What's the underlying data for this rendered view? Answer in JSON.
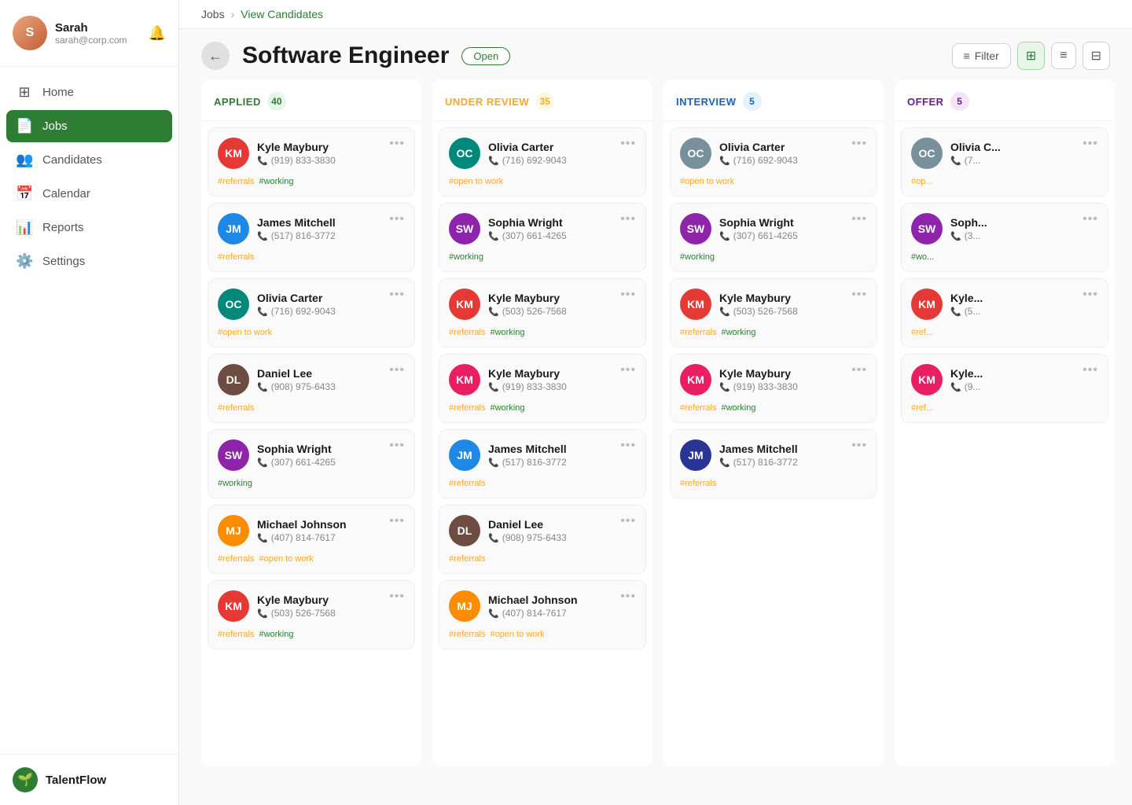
{
  "sidebar": {
    "user": {
      "name": "Sarah",
      "email": "sarah@corp.com",
      "initials": "S"
    },
    "nav": [
      {
        "id": "home",
        "label": "Home",
        "icon": "⊞"
      },
      {
        "id": "jobs",
        "label": "Jobs",
        "icon": "📄",
        "active": true
      },
      {
        "id": "candidates",
        "label": "Candidates",
        "icon": "👥"
      },
      {
        "id": "calendar",
        "label": "Calendar",
        "icon": "📅"
      },
      {
        "id": "reports",
        "label": "Reports",
        "icon": "📊"
      },
      {
        "id": "settings",
        "label": "Settings",
        "icon": "⚙️"
      }
    ],
    "brand": {
      "name": "TalentFlow",
      "icon": "🌱"
    }
  },
  "header": {
    "breadcrumb_jobs": "Jobs",
    "breadcrumb_current": "View Candidates",
    "back_button": "←",
    "title": "Software Engineer",
    "status": "Open",
    "filter_label": "Filter"
  },
  "columns": [
    {
      "id": "applied",
      "title": "APPLIED",
      "count": "40",
      "colorClass": "applied",
      "candidates": [
        {
          "name": "Kyle Maybury",
          "phone": "(919) 833-3830",
          "tags": [
            "#referrals",
            "#working"
          ],
          "tagClasses": [
            "referrals",
            "working"
          ],
          "avatarClass": "avatar-red",
          "initials": "KM"
        },
        {
          "name": "James Mitchell",
          "phone": "(517) 816-3772",
          "tags": [
            "#referrals"
          ],
          "tagClasses": [
            "referrals"
          ],
          "avatarClass": "avatar-blue",
          "initials": "JM"
        },
        {
          "name": "Olivia Carter",
          "phone": "(716) 692-9043",
          "tags": [
            "#open to work"
          ],
          "tagClasses": [
            "open-to-work"
          ],
          "avatarClass": "avatar-teal",
          "initials": "OC"
        },
        {
          "name": "Daniel Lee",
          "phone": "(908) 975-6433",
          "tags": [
            "#referrals"
          ],
          "tagClasses": [
            "referrals"
          ],
          "avatarClass": "avatar-brown",
          "initials": "DL"
        },
        {
          "name": "Sophia Wright",
          "phone": "(307) 661-4265",
          "tags": [
            "#working"
          ],
          "tagClasses": [
            "working"
          ],
          "avatarClass": "avatar-purple",
          "initials": "SW"
        },
        {
          "name": "Michael Johnson",
          "phone": "(407) 814-7617",
          "tags": [
            "#referrals",
            "#open to work"
          ],
          "tagClasses": [
            "referrals",
            "open-to-work"
          ],
          "avatarClass": "avatar-orange",
          "initials": "MJ"
        },
        {
          "name": "Kyle Maybury",
          "phone": "(503) 526-7568",
          "tags": [
            "#referrals",
            "#working"
          ],
          "tagClasses": [
            "referrals",
            "working"
          ],
          "avatarClass": "avatar-red",
          "initials": "KM"
        }
      ]
    },
    {
      "id": "review",
      "title": "UNDER REVIEW",
      "count": "35",
      "colorClass": "review",
      "candidates": [
        {
          "name": "Olivia Carter",
          "phone": "(716) 692-9043",
          "tags": [
            "#open to work"
          ],
          "tagClasses": [
            "open-to-work"
          ],
          "avatarClass": "avatar-teal",
          "initials": "OC"
        },
        {
          "name": "Sophia Wright",
          "phone": "(307) 661-4265",
          "tags": [
            "#working"
          ],
          "tagClasses": [
            "working"
          ],
          "avatarClass": "avatar-purple",
          "initials": "SW"
        },
        {
          "name": "Kyle Maybury",
          "phone": "(503) 526-7568",
          "tags": [
            "#referrals",
            "#working"
          ],
          "tagClasses": [
            "referrals",
            "working"
          ],
          "avatarClass": "avatar-red",
          "initials": "KM"
        },
        {
          "name": "Kyle Maybury",
          "phone": "(919) 833-3830",
          "tags": [
            "#referrals",
            "#working"
          ],
          "tagClasses": [
            "referrals",
            "working"
          ],
          "avatarClass": "avatar-pink",
          "initials": "KM"
        },
        {
          "name": "James Mitchell",
          "phone": "(517) 816-3772",
          "tags": [
            "#referrals"
          ],
          "tagClasses": [
            "referrals"
          ],
          "avatarClass": "avatar-blue",
          "initials": "JM"
        },
        {
          "name": "Daniel Lee",
          "phone": "(908) 975-6433",
          "tags": [
            "#referrals"
          ],
          "tagClasses": [
            "referrals"
          ],
          "avatarClass": "avatar-brown",
          "initials": "DL"
        },
        {
          "name": "Michael Johnson",
          "phone": "(407) 814-7617",
          "tags": [
            "#referrals",
            "#open to work"
          ],
          "tagClasses": [
            "referrals",
            "open-to-work"
          ],
          "avatarClass": "avatar-orange",
          "initials": "MJ"
        }
      ]
    },
    {
      "id": "interview",
      "title": "INTERVIEW",
      "count": "5",
      "colorClass": "interview",
      "candidates": [
        {
          "name": "Olivia Carter",
          "phone": "(716) 692-9043",
          "tags": [
            "#open to work"
          ],
          "tagClasses": [
            "open-to-work"
          ],
          "avatarClass": "avatar-grey",
          "initials": "OC"
        },
        {
          "name": "Sophia Wright",
          "phone": "(307) 661-4265",
          "tags": [
            "#working"
          ],
          "tagClasses": [
            "working"
          ],
          "avatarClass": "avatar-purple",
          "initials": "SW"
        },
        {
          "name": "Kyle Maybury",
          "phone": "(503) 526-7568",
          "tags": [
            "#referrals",
            "#working"
          ],
          "tagClasses": [
            "referrals",
            "working"
          ],
          "avatarClass": "avatar-red",
          "initials": "KM"
        },
        {
          "name": "Kyle Maybury",
          "phone": "(919) 833-3830",
          "tags": [
            "#referrals",
            "#working"
          ],
          "tagClasses": [
            "referrals",
            "working"
          ],
          "avatarClass": "avatar-pink",
          "initials": "KM"
        },
        {
          "name": "James Mitchell",
          "phone": "(517) 816-3772",
          "tags": [
            "#referrals"
          ],
          "tagClasses": [
            "referrals"
          ],
          "avatarClass": "avatar-darkblue",
          "initials": "JM"
        }
      ]
    },
    {
      "id": "offer",
      "title": "OFFER",
      "count": "5",
      "colorClass": "offer",
      "candidates": [
        {
          "name": "Olivia C...",
          "phone": "(7...",
          "tags": [
            "#op..."
          ],
          "tagClasses": [
            "open-to-work"
          ],
          "avatarClass": "avatar-grey",
          "initials": "OC"
        },
        {
          "name": "Soph...",
          "phone": "(3...",
          "tags": [
            "#wo..."
          ],
          "tagClasses": [
            "working"
          ],
          "avatarClass": "avatar-purple",
          "initials": "SW"
        },
        {
          "name": "Kyle...",
          "phone": "(5...",
          "tags": [
            "#ref..."
          ],
          "tagClasses": [
            "referrals"
          ],
          "avatarClass": "avatar-red",
          "initials": "KM"
        },
        {
          "name": "Kyle...",
          "phone": "(9...",
          "tags": [
            "#ref..."
          ],
          "tagClasses": [
            "referrals"
          ],
          "avatarClass": "avatar-pink",
          "initials": "KM"
        }
      ]
    }
  ]
}
